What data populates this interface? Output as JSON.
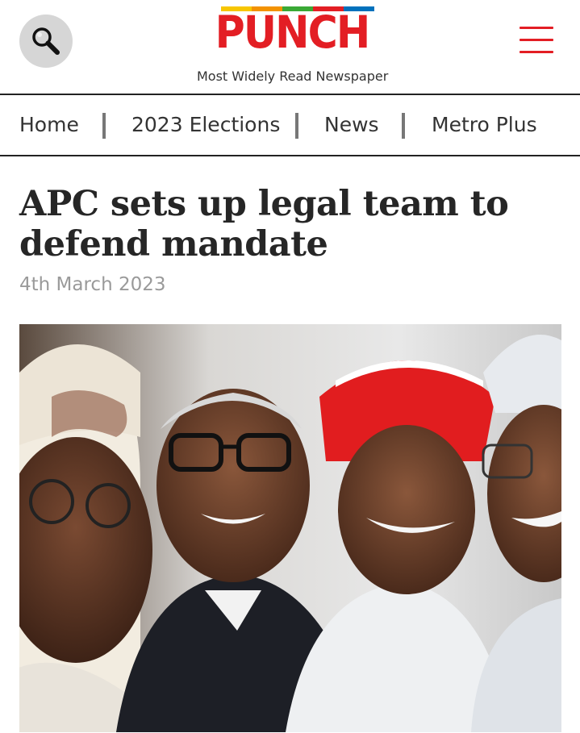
{
  "header": {
    "logo_text": "PUNCH",
    "tagline": "Most Widely Read Newspaper",
    "logo_bar_colors": [
      "#f7c600",
      "#f39200",
      "#3aa935",
      "#e31e24",
      "#0071bc"
    ],
    "brand_color": "#e31e24"
  },
  "icons": {
    "search": "search-icon",
    "menu": "hamburger-menu-icon"
  },
  "nav": {
    "items": [
      {
        "label": "Home"
      },
      {
        "label": "2023 Elections"
      },
      {
        "label": "News"
      },
      {
        "label": "Metro Plus"
      }
    ]
  },
  "article": {
    "title": "APC sets up legal team to defend mandate",
    "date": "4th March 2023"
  }
}
